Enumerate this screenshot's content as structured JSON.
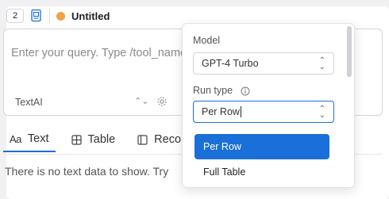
{
  "header": {
    "badge_count": "2",
    "doc_icon": "document-icon",
    "status_color": "#f0a24a",
    "title": "Untitled"
  },
  "query": {
    "placeholder": "Enter your query. Type /tool_name",
    "model_value": "TextAI"
  },
  "tabs": [
    {
      "icon": "text-icon",
      "glyph": "Aa",
      "label": "Text",
      "active": true
    },
    {
      "icon": "table-icon",
      "label": "Table"
    },
    {
      "icon": "record-icon",
      "label": "Reco"
    }
  ],
  "empty_state": "There is no text data to show. Try",
  "popover": {
    "model_label": "Model",
    "model_value": "GPT-4 Turbo",
    "run_type_label": "Run type",
    "run_type_value": "Per Row",
    "options": [
      {
        "label": "Per Row",
        "selected": true
      },
      {
        "label": "Full Table",
        "selected": false
      }
    ]
  },
  "colors": {
    "accent": "#1a6fd9",
    "status": "#f0a24a"
  }
}
